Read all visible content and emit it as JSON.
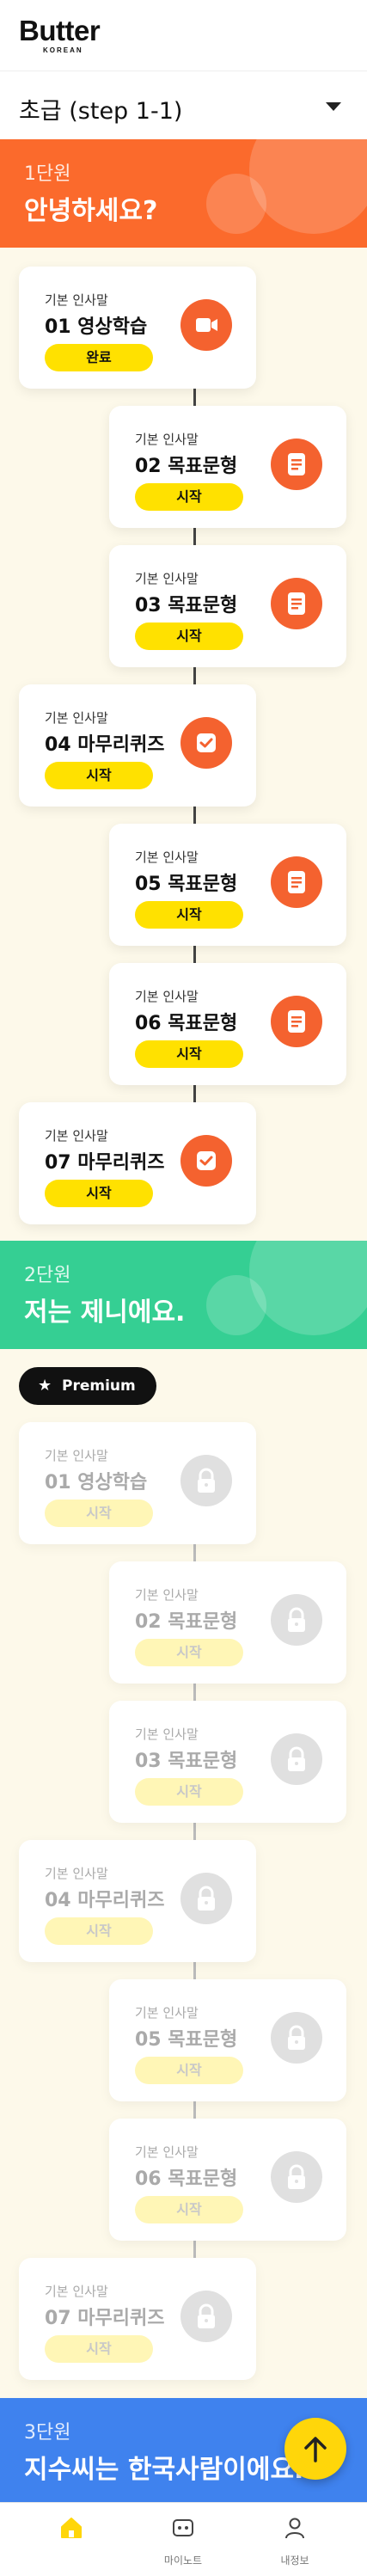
{
  "app": {
    "logo_text": "Butter",
    "logo_sub": "KOREAN"
  },
  "level_selector": {
    "label": "초급 (step 1-1)"
  },
  "units": [
    {
      "number": "1단원",
      "title": "안녕하세요?",
      "color": "#fb6a2c",
      "lessons": [
        {
          "category": "기본 인사말",
          "name": "01 영상학습",
          "button": "완료",
          "icon": "video-icon",
          "locked": false
        },
        {
          "category": "기본 인사말",
          "name": "02 목표문형",
          "button": "시작",
          "icon": "document-icon",
          "locked": false
        },
        {
          "category": "기본 인사말",
          "name": "03 목표문형",
          "button": "시작",
          "icon": "document-icon",
          "locked": false
        },
        {
          "category": "기본 인사말",
          "name": "04 마무리퀴즈",
          "button": "시작",
          "icon": "checkbox-icon",
          "locked": false
        },
        {
          "category": "기본 인사말",
          "name": "05 목표문형",
          "button": "시작",
          "icon": "document-icon",
          "locked": false
        },
        {
          "category": "기본 인사말",
          "name": "06 목표문형",
          "button": "시작",
          "icon": "document-icon",
          "locked": false
        },
        {
          "category": "기본 인사말",
          "name": "07 마무리퀴즈",
          "button": "시작",
          "icon": "checkbox-icon",
          "locked": false
        }
      ]
    },
    {
      "number": "2단원",
      "title": "저는 제니에요.",
      "color": "#35cf93",
      "premium_label": "Premium",
      "lessons": [
        {
          "category": "기본 인사말",
          "name": "01 영상학습",
          "button": "시작",
          "icon": "lock-icon",
          "locked": true
        },
        {
          "category": "기본 인사말",
          "name": "02 목표문형",
          "button": "시작",
          "icon": "lock-icon",
          "locked": true
        },
        {
          "category": "기본 인사말",
          "name": "03 목표문형",
          "button": "시작",
          "icon": "lock-icon",
          "locked": true
        },
        {
          "category": "기본 인사말",
          "name": "04 마무리퀴즈",
          "button": "시작",
          "icon": "lock-icon",
          "locked": true
        },
        {
          "category": "기본 인사말",
          "name": "05 목표문형",
          "button": "시작",
          "icon": "lock-icon",
          "locked": true
        },
        {
          "category": "기본 인사말",
          "name": "06 목표문형",
          "button": "시작",
          "icon": "lock-icon",
          "locked": true
        },
        {
          "category": "기본 인사말",
          "name": "07 마무리퀴즈",
          "button": "시작",
          "icon": "lock-icon",
          "locked": true
        }
      ]
    },
    {
      "number": "3단원",
      "title": "지수씨는 한국사람이에요.",
      "color": "#3f82ee"
    }
  ],
  "bottom_nav": [
    {
      "label": "",
      "icon": "home-icon",
      "active": true
    },
    {
      "label": "마이노트",
      "icon": "note-icon",
      "active": false
    },
    {
      "label": "내정보",
      "icon": "profile-icon",
      "active": false
    }
  ],
  "fab": {
    "icon": "arrow-up-icon"
  },
  "colors": {
    "accent_yellow": "#ffe100",
    "accent_orange": "#f4622f",
    "background": "#fdf9ea"
  }
}
